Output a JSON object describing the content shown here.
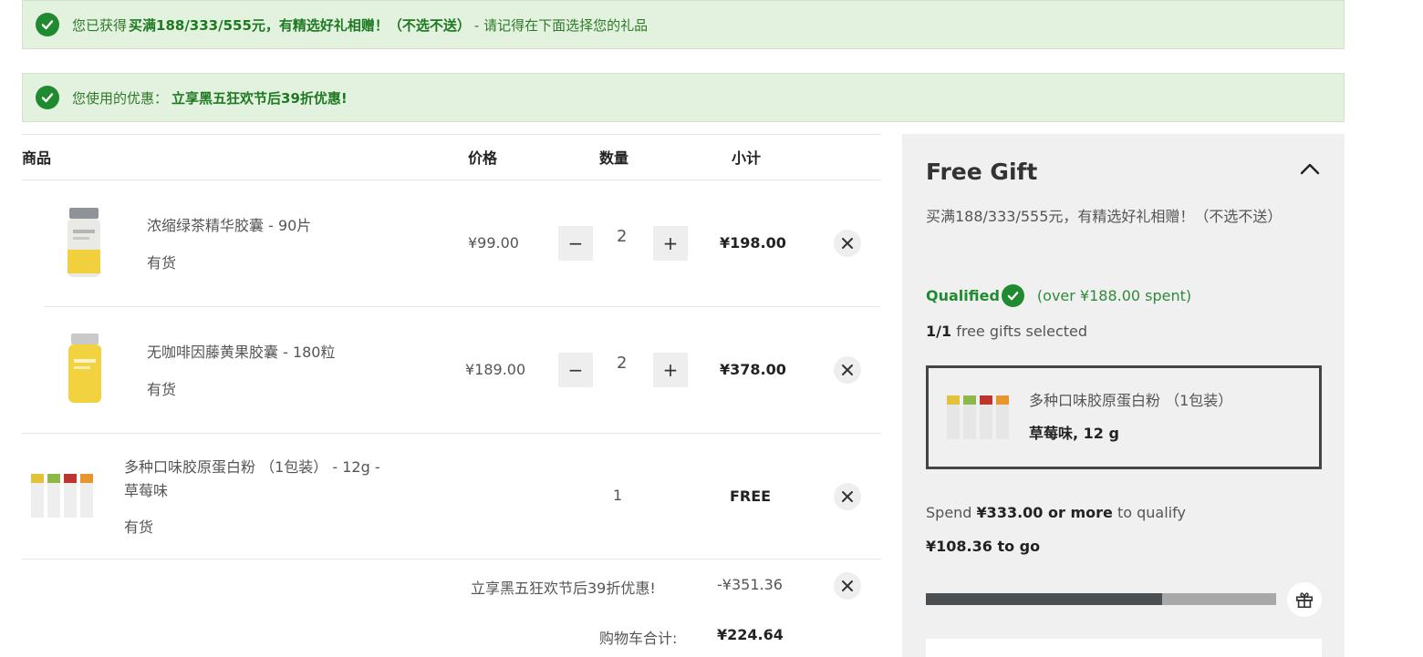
{
  "banners": {
    "gift": {
      "pre": "您已获得",
      "bold": "买满188/333/555元，有精选好礼相赠！（不选不送）",
      "post": "- 请记得在下面选择您的礼品"
    },
    "promo": {
      "pre": "您使用的优惠：",
      "bold": "立享黑五狂欢节后39折优惠!"
    }
  },
  "table": {
    "headers": {
      "product": "商品",
      "price": "价格",
      "qty": "数量",
      "subtotal": "小计"
    },
    "items": [
      {
        "name": "浓缩绿茶精华胶囊 - 90片",
        "stock": "有货",
        "price": "¥99.00",
        "qty": "2",
        "subtotal": "¥198.00"
      },
      {
        "name": "无咖啡因藤黄果胶囊 - 180粒",
        "stock": "有货",
        "price": "¥189.00",
        "qty": "2",
        "subtotal": "¥378.00"
      },
      {
        "name_line1": "多种口味胶原蛋白粉 （1包装） - 12g -",
        "name_line2": "草莓味",
        "stock": "有货",
        "qty": "1",
        "subtotal": "FREE"
      }
    ],
    "minus": "−",
    "plus": "+"
  },
  "totals": {
    "discount_label": "立享黑五狂欢节后39折优惠!",
    "discount_value": "-¥351.36",
    "cart_total_label": "购物车合计:",
    "cart_total_value": "¥224.64"
  },
  "gift_panel": {
    "title": "Free Gift",
    "description": "买满188/333/555元，有精选好礼相赠！（不选不送）",
    "qualified_label": "Qualified",
    "qualified_note": "(over ¥188.00 spent)",
    "selected_count": "1/1",
    "selected_text": "free gifts selected",
    "selected_gift_name": "多种口味胶原蛋白粉 （1包装）",
    "selected_gift_variant": "草莓味, 12 g",
    "spend_pre": "Spend",
    "spend_amount": "¥333.00 or more",
    "spend_post": "to qualify",
    "to_go": "¥108.36 to go",
    "progress": 0.675
  },
  "colors": {
    "accent_green": "#1f8a2f",
    "banner_bg": "#e3f1df",
    "panel_bg": "#f0f0f0",
    "progress_fill": "#4c4f52",
    "progress_track": "#a8a8a8"
  },
  "icons": [
    "check-circle-icon",
    "minus-icon",
    "plus-icon",
    "close-icon",
    "chevron-up-icon",
    "gift-icon"
  ]
}
